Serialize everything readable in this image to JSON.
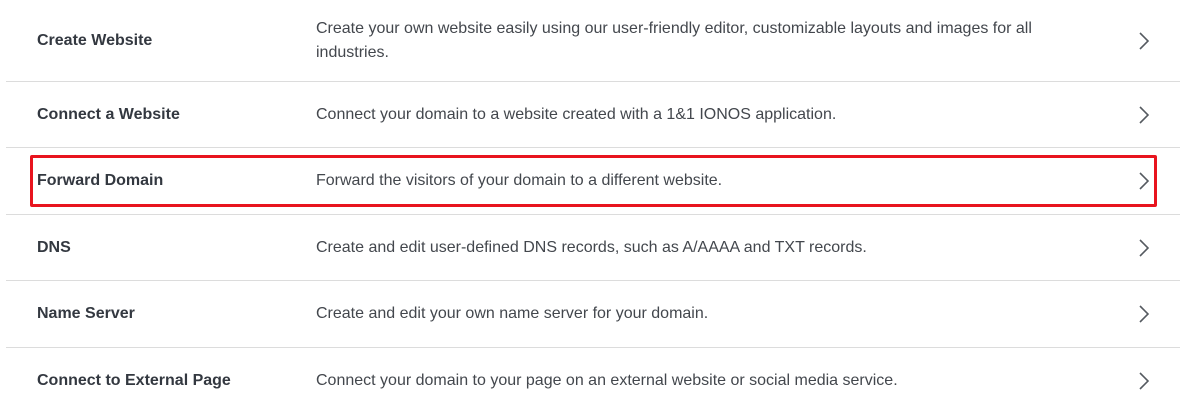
{
  "settings_list": {
    "items": [
      {
        "name": "Create Website",
        "description": "Create your own website easily using our user-friendly editor, customizable layouts and images for all industries."
      },
      {
        "name": "Connect a Website",
        "description": "Connect your domain to a website created with a 1&1 IONOS application."
      },
      {
        "name": "Forward Domain",
        "description": "Forward the visitors of your domain to a different website."
      },
      {
        "name": "DNS",
        "description": "Create and edit user-defined DNS records, such as A/AAAA and TXT records."
      },
      {
        "name": "Name Server",
        "description": "Create and edit your own name server for your domain."
      },
      {
        "name": "Connect to External Page",
        "description": "Connect your domain to your page on an external website or social media service."
      }
    ],
    "highlighted_item": "Forward Domain"
  },
  "colors": {
    "highlight_border": "#e8141e",
    "divider": "#dcdcdc",
    "name_text": "#333840",
    "description_text": "#43474d"
  },
  "icons": {
    "row_chevron": "chevron-right-icon"
  }
}
